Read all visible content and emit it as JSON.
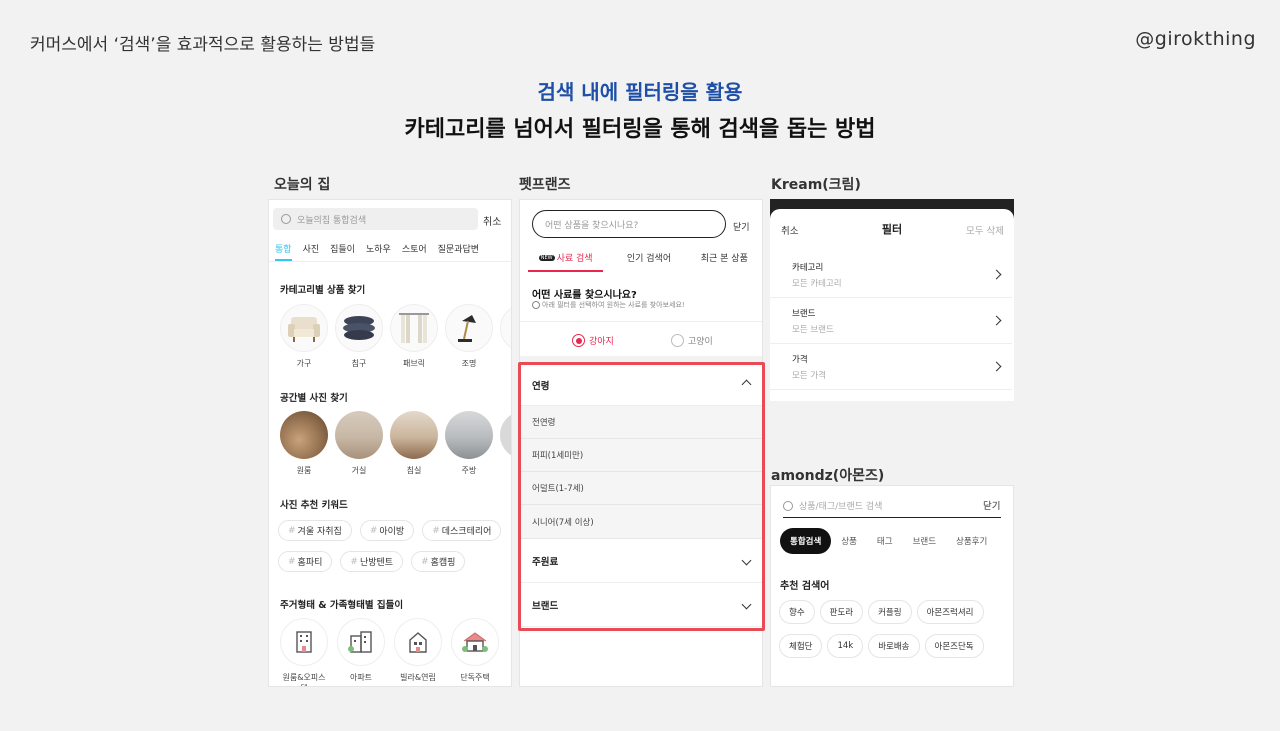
{
  "header": {
    "left_title": "커머스에서 ‘검색’을 효과적으로 활용하는 방법들",
    "brand": "@girokthing"
  },
  "slide": {
    "subtitle": "검색 내에 필터링을 활용",
    "title": "카테고리를 넘어서 필터링을 통해 검색을 돕는 방법"
  },
  "ohouse": {
    "label": "오늘의 집",
    "search_placeholder": "오늘의집 통합검색",
    "cancel": "취소",
    "tabs": [
      "통합",
      "사진",
      "집들이",
      "노하우",
      "스토어",
      "질문과답변"
    ],
    "section1": "카테고리별 상품 찾기",
    "categories": [
      "가구",
      "침구",
      "패브릭",
      "조명"
    ],
    "section2": "공간별 사진 찾기",
    "spaces": [
      "원룸",
      "거실",
      "침실",
      "주방"
    ],
    "section3": "사진 추천 키워드",
    "hash": "#",
    "keywords": [
      "겨울 자취집",
      "아이방",
      "데스크테리어",
      "홈파티",
      "난방텐트",
      "홈캠핑"
    ],
    "section4": "주거형태 & 가족형태별 집들이",
    "housing": [
      "원룸&오피스텔",
      "아파트",
      "빌라&연립",
      "단독주택"
    ]
  },
  "petfriends": {
    "label": "펫프랜즈",
    "search_placeholder": "어떤 상품을 찾으시나요?",
    "close": "닫기",
    "tabs": [
      "사료 검색",
      "인기 검색어",
      "최근 본 상품"
    ],
    "new_badge": "NEW",
    "question": "어떤 사료를 찾으시나요?",
    "hint": "아래 필터를 선택하여 원하는 사료를 찾아보세요!",
    "radio_dog": "강아지",
    "radio_cat": "고양이",
    "filter_age": "연령",
    "age_options": [
      "전연령",
      "퍼피(1세미만)",
      "어덜트(1-7세)",
      "시니어(7세 이상)"
    ],
    "filter_ingredient": "주원료",
    "filter_brand": "브랜드",
    "highlight_color": "#e84b53"
  },
  "kream": {
    "label": "Kream(크림)",
    "cancel": "취소",
    "title": "필터",
    "clear_all": "모두 삭제",
    "rows": [
      {
        "title": "카테고리",
        "value": "모든 카테고리"
      },
      {
        "title": "브랜드",
        "value": "모든 브랜드"
      },
      {
        "title": "가격",
        "value": "모든 가격"
      }
    ]
  },
  "amondz": {
    "label": "amondz(아몬즈)",
    "search_placeholder": "상품/태그/브랜드 검색",
    "close": "닫기",
    "tabs": [
      "통합검색",
      "상품",
      "태그",
      "브랜드",
      "상품후기"
    ],
    "section": "추천 검색어",
    "keywords": [
      "향수",
      "판도라",
      "커플링",
      "아몬즈럭셔리",
      "체험단",
      "14k",
      "바로배송",
      "아몬즈단독"
    ]
  }
}
